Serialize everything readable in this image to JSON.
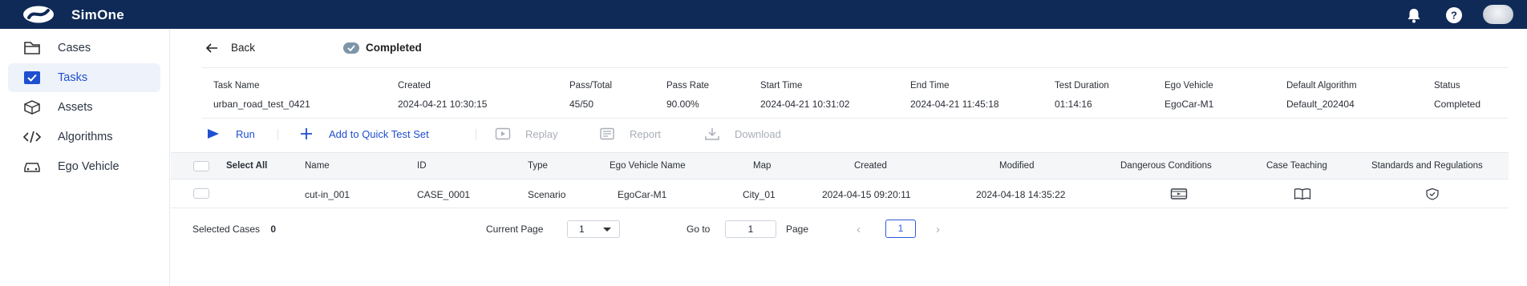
{
  "app": {
    "name": "SimOne"
  },
  "sidebar": {
    "items": [
      {
        "label": "Cases",
        "icon": "folder-icon"
      },
      {
        "label": "Tasks",
        "icon": "task-check-icon",
        "active": true
      },
      {
        "label": "Assets",
        "icon": "cube-icon"
      },
      {
        "label": "Algorithms",
        "icon": "code-icon"
      },
      {
        "label": "Ego Vehicle",
        "icon": "car-icon"
      }
    ]
  },
  "header": {
    "back_label": "Back",
    "status_label": "Completed"
  },
  "task_info": {
    "fields": [
      {
        "key": "Task Name",
        "value": "urban_road_test_0421"
      },
      {
        "key": "Created",
        "value": "2024-04-21 10:30:15"
      },
      {
        "key": "Pass/Total",
        "value": "45/50"
      },
      {
        "key": "Pass Rate",
        "value": "90.00%"
      },
      {
        "key": "Start Time",
        "value": "2024-04-21 10:31:02"
      },
      {
        "key": "End Time",
        "value": "2024-04-21 11:45:18"
      },
      {
        "key": "Test Duration",
        "value": "01:14:16"
      },
      {
        "key": "Ego Vehicle",
        "value": "EgoCar-M1"
      },
      {
        "key": "Default Algorithm",
        "value": "Default_202404"
      },
      {
        "key": "Status",
        "value": "Completed"
      }
    ]
  },
  "toolbar": {
    "run": "Run",
    "add_quick": "Add to Quick Test Set",
    "replay": "Replay",
    "report": "Report",
    "download": "Download"
  },
  "table": {
    "columns": [
      "Select All",
      "Name",
      "ID",
      "Type",
      "Ego Vehicle Name",
      "Map",
      "Created",
      "Modified",
      "Dangerous Conditions",
      "Case Teaching",
      "Standards and Regulations"
    ],
    "rows": [
      {
        "name": "cut-in_001",
        "id": "CASE_0001",
        "type": "Scenario",
        "ego": "EgoCar-M1",
        "map": "City_01",
        "created": "2024-04-15 09:20:11",
        "modified": "2024-04-18 14:35:22"
      }
    ]
  },
  "footer": {
    "selected_label": "Selected Cases",
    "selected_count": "0",
    "current_page_label": "Current Page",
    "current_page_value": "1",
    "goto_label": "Go to",
    "goto_value": "1",
    "page_label": "Page",
    "page_current": "1"
  },
  "colors": {
    "topbar": "#0f2a57",
    "accent": "#1f4fd0",
    "active_bg": "#eef2fb"
  }
}
